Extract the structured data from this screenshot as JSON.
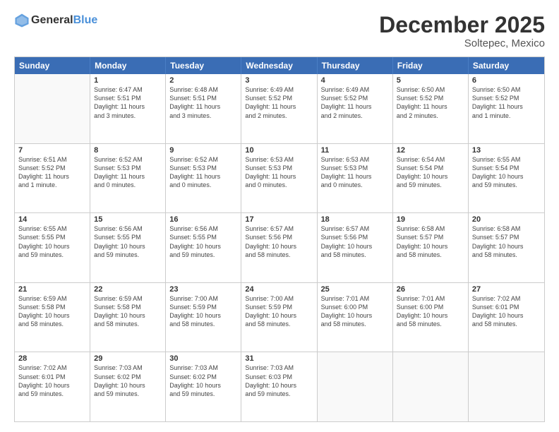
{
  "header": {
    "logo_general": "General",
    "logo_blue": "Blue",
    "month_title": "December 2025",
    "subtitle": "Soltepec, Mexico"
  },
  "days_of_week": [
    "Sunday",
    "Monday",
    "Tuesday",
    "Wednesday",
    "Thursday",
    "Friday",
    "Saturday"
  ],
  "weeks": [
    [
      {
        "day": "",
        "info": ""
      },
      {
        "day": "1",
        "info": "Sunrise: 6:47 AM\nSunset: 5:51 PM\nDaylight: 11 hours\nand 3 minutes."
      },
      {
        "day": "2",
        "info": "Sunrise: 6:48 AM\nSunset: 5:51 PM\nDaylight: 11 hours\nand 3 minutes."
      },
      {
        "day": "3",
        "info": "Sunrise: 6:49 AM\nSunset: 5:52 PM\nDaylight: 11 hours\nand 2 minutes."
      },
      {
        "day": "4",
        "info": "Sunrise: 6:49 AM\nSunset: 5:52 PM\nDaylight: 11 hours\nand 2 minutes."
      },
      {
        "day": "5",
        "info": "Sunrise: 6:50 AM\nSunset: 5:52 PM\nDaylight: 11 hours\nand 2 minutes."
      },
      {
        "day": "6",
        "info": "Sunrise: 6:50 AM\nSunset: 5:52 PM\nDaylight: 11 hours\nand 1 minute."
      }
    ],
    [
      {
        "day": "7",
        "info": "Sunrise: 6:51 AM\nSunset: 5:52 PM\nDaylight: 11 hours\nand 1 minute."
      },
      {
        "day": "8",
        "info": "Sunrise: 6:52 AM\nSunset: 5:53 PM\nDaylight: 11 hours\nand 0 minutes."
      },
      {
        "day": "9",
        "info": "Sunrise: 6:52 AM\nSunset: 5:53 PM\nDaylight: 11 hours\nand 0 minutes."
      },
      {
        "day": "10",
        "info": "Sunrise: 6:53 AM\nSunset: 5:53 PM\nDaylight: 11 hours\nand 0 minutes."
      },
      {
        "day": "11",
        "info": "Sunrise: 6:53 AM\nSunset: 5:53 PM\nDaylight: 11 hours\nand 0 minutes."
      },
      {
        "day": "12",
        "info": "Sunrise: 6:54 AM\nSunset: 5:54 PM\nDaylight: 10 hours\nand 59 minutes."
      },
      {
        "day": "13",
        "info": "Sunrise: 6:55 AM\nSunset: 5:54 PM\nDaylight: 10 hours\nand 59 minutes."
      }
    ],
    [
      {
        "day": "14",
        "info": "Sunrise: 6:55 AM\nSunset: 5:55 PM\nDaylight: 10 hours\nand 59 minutes."
      },
      {
        "day": "15",
        "info": "Sunrise: 6:56 AM\nSunset: 5:55 PM\nDaylight: 10 hours\nand 59 minutes."
      },
      {
        "day": "16",
        "info": "Sunrise: 6:56 AM\nSunset: 5:55 PM\nDaylight: 10 hours\nand 59 minutes."
      },
      {
        "day": "17",
        "info": "Sunrise: 6:57 AM\nSunset: 5:56 PM\nDaylight: 10 hours\nand 58 minutes."
      },
      {
        "day": "18",
        "info": "Sunrise: 6:57 AM\nSunset: 5:56 PM\nDaylight: 10 hours\nand 58 minutes."
      },
      {
        "day": "19",
        "info": "Sunrise: 6:58 AM\nSunset: 5:57 PM\nDaylight: 10 hours\nand 58 minutes."
      },
      {
        "day": "20",
        "info": "Sunrise: 6:58 AM\nSunset: 5:57 PM\nDaylight: 10 hours\nand 58 minutes."
      }
    ],
    [
      {
        "day": "21",
        "info": "Sunrise: 6:59 AM\nSunset: 5:58 PM\nDaylight: 10 hours\nand 58 minutes."
      },
      {
        "day": "22",
        "info": "Sunrise: 6:59 AM\nSunset: 5:58 PM\nDaylight: 10 hours\nand 58 minutes."
      },
      {
        "day": "23",
        "info": "Sunrise: 7:00 AM\nSunset: 5:59 PM\nDaylight: 10 hours\nand 58 minutes."
      },
      {
        "day": "24",
        "info": "Sunrise: 7:00 AM\nSunset: 5:59 PM\nDaylight: 10 hours\nand 58 minutes."
      },
      {
        "day": "25",
        "info": "Sunrise: 7:01 AM\nSunset: 6:00 PM\nDaylight: 10 hours\nand 58 minutes."
      },
      {
        "day": "26",
        "info": "Sunrise: 7:01 AM\nSunset: 6:00 PM\nDaylight: 10 hours\nand 58 minutes."
      },
      {
        "day": "27",
        "info": "Sunrise: 7:02 AM\nSunset: 6:01 PM\nDaylight: 10 hours\nand 58 minutes."
      }
    ],
    [
      {
        "day": "28",
        "info": "Sunrise: 7:02 AM\nSunset: 6:01 PM\nDaylight: 10 hours\nand 59 minutes."
      },
      {
        "day": "29",
        "info": "Sunrise: 7:03 AM\nSunset: 6:02 PM\nDaylight: 10 hours\nand 59 minutes."
      },
      {
        "day": "30",
        "info": "Sunrise: 7:03 AM\nSunset: 6:02 PM\nDaylight: 10 hours\nand 59 minutes."
      },
      {
        "day": "31",
        "info": "Sunrise: 7:03 AM\nSunset: 6:03 PM\nDaylight: 10 hours\nand 59 minutes."
      },
      {
        "day": "",
        "info": ""
      },
      {
        "day": "",
        "info": ""
      },
      {
        "day": "",
        "info": ""
      }
    ]
  ]
}
